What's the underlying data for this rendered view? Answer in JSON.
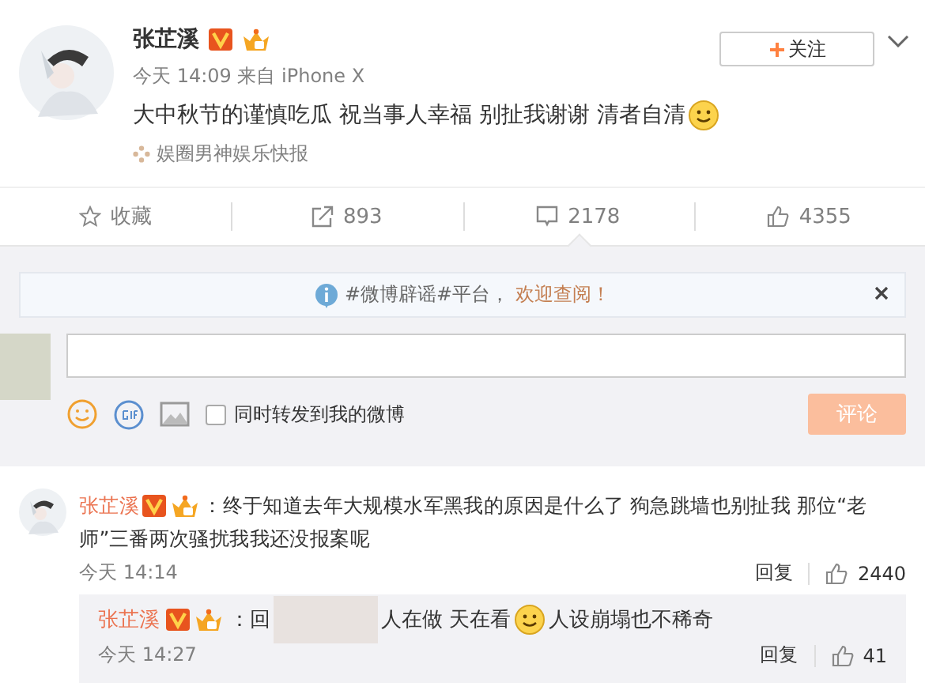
{
  "post": {
    "author": "张芷溪",
    "verified": true,
    "meta": "今天 14:09 来自 iPhone X",
    "text": "大中秋节的谨慎吃瓜 祝当事人幸福 别扯我谢谢 清者自清",
    "source": "娱圈男神娱乐快报",
    "follow_label": "关注"
  },
  "actions": [
    {
      "kind": "star",
      "label": "收藏"
    },
    {
      "kind": "repost",
      "label": "893"
    },
    {
      "kind": "comment",
      "label": "2178",
      "selected": true
    },
    {
      "kind": "like",
      "label": "4355"
    }
  ],
  "notice": {
    "text": "#微博辟谣#平台，",
    "link": "欢迎查阅！"
  },
  "composer": {
    "also_repost": {
      "label": "同时转发到我的微博",
      "checked": false
    },
    "submit": "评论"
  },
  "comments": [
    {
      "author": "张芷溪",
      "text": "：终于知道去年大规模水军黑我的原因是什么了 狗急跳墙也别扯我 那位“老师”三番两次骚扰我我还没报案呢",
      "time": "今天 14:14",
      "reply_label": "回复",
      "likes": "2440",
      "reply": {
        "author": "张芷溪",
        "prefix": "：回",
        "text1": "人在做 天在看",
        "text2": "人设崩塌也不稀奇",
        "time": "今天 14:27",
        "reply_label": "回复",
        "likes": "41"
      }
    }
  ]
}
